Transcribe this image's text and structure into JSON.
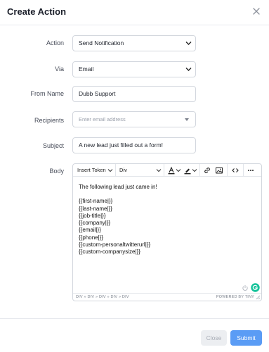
{
  "dialog": {
    "title": "Create Action"
  },
  "form": {
    "action": {
      "label": "Action",
      "value": "Send Notification"
    },
    "via": {
      "label": "Via",
      "value": "Email"
    },
    "from_name": {
      "label": "From Name",
      "value": "Dubb Support"
    },
    "recipients": {
      "label": "Recipients",
      "placeholder": "Enter email address"
    },
    "subject": {
      "label": "Subject",
      "value": "A new lead just filled out a form!"
    },
    "body": {
      "label": "Body"
    }
  },
  "editor": {
    "toolbar": {
      "insert_token": "Insert Token",
      "block_format": "Div"
    },
    "content": {
      "intro": "The following lead just came in!",
      "tokens": [
        "{{first-name|}}",
        "{{last-name|}}",
        "{{job-title|}}",
        "{{company|}}",
        "{{email|}}",
        "{{phone|}}",
        "{{custom-personaltwitterurl|}}",
        "{{custom-companysize|}}"
      ]
    },
    "statusbar": {
      "path": "DIV » DIV » DIV » DIV » DIV",
      "powered_by": "POWERED BY TINY"
    },
    "colors": {
      "grammarly_green": "#15c39a"
    }
  },
  "footer": {
    "close_label": "Close",
    "submit_label": "Submit"
  },
  "colors": {
    "primary": "#5a9cf5",
    "disabled_bg": "#eceef1"
  }
}
